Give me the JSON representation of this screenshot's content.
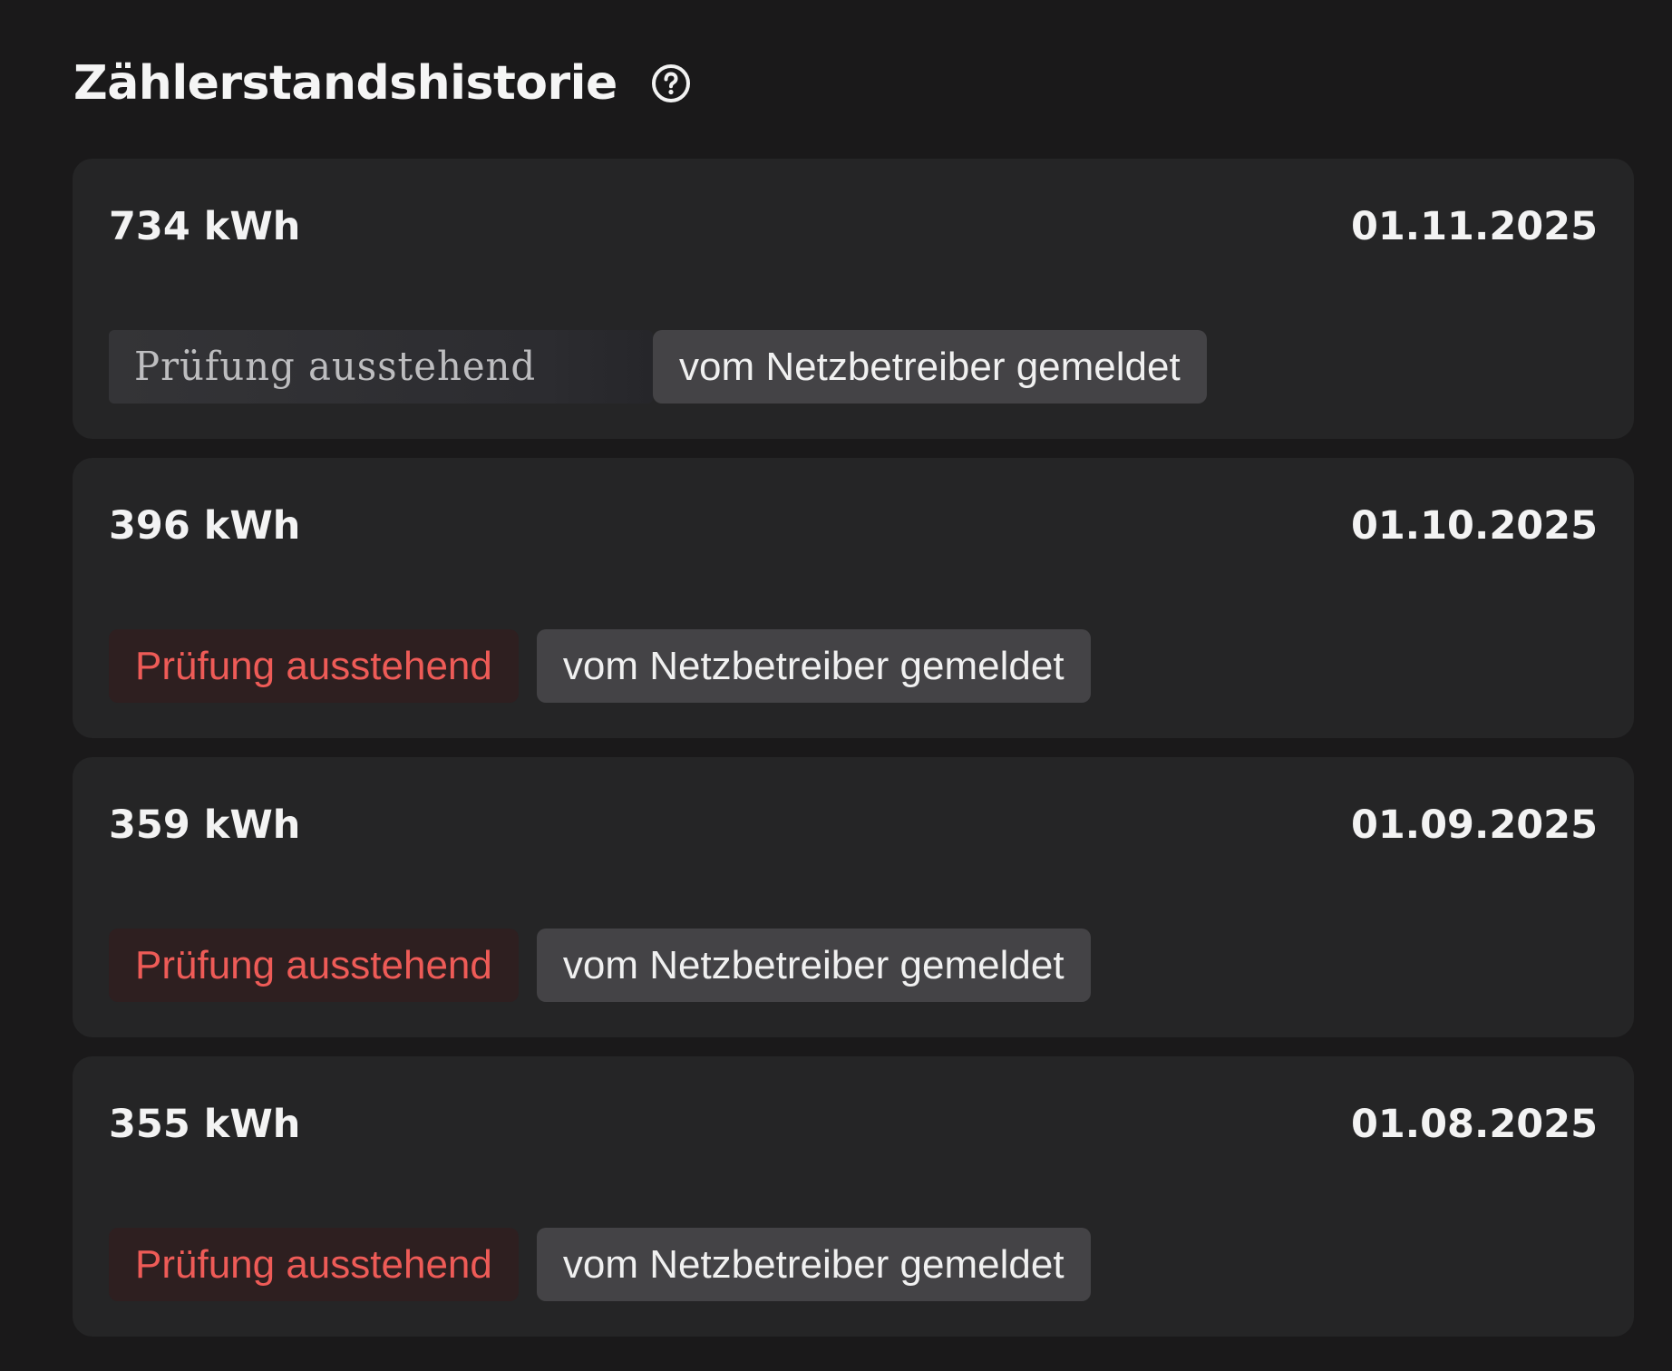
{
  "page": {
    "title": "Zählerstandshistorie",
    "help_icon": "help-circle-icon"
  },
  "entries": [
    {
      "value": "734 kWh",
      "date": "01.11.2025",
      "status": "Prüfung ausstehend",
      "source": "vom Netzbetreiber gemeldet"
    },
    {
      "value": "396 kWh",
      "date": "01.10.2025",
      "status": "Prüfung ausstehend",
      "source": "vom Netzbetreiber gemeldet"
    },
    {
      "value": "359 kWh",
      "date": "01.09.2025",
      "status": "Prüfung ausstehend",
      "source": "vom Netzbetreiber gemeldet"
    },
    {
      "value": "355 kWh",
      "date": "01.08.2025",
      "status": "Prüfung ausstehend",
      "source": "vom Netzbetreiber gemeldet"
    }
  ],
  "colors": {
    "background": "#1a191a",
    "card": "#252526",
    "status_text": "#ee5b57",
    "status_bg": "#2e1f20",
    "source_bg": "#444346"
  }
}
